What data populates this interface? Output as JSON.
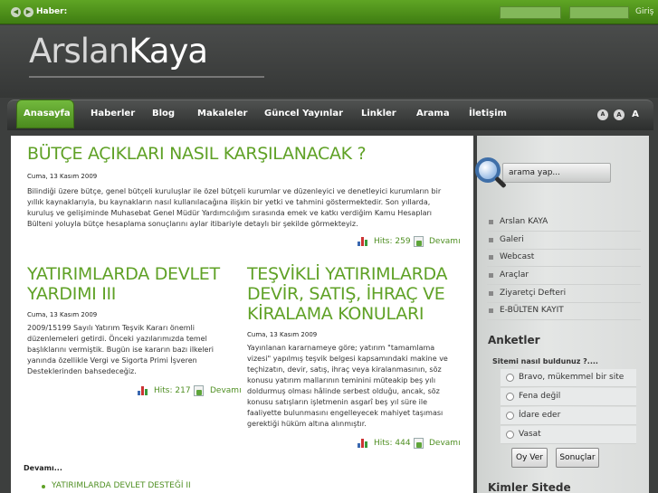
{
  "topbar": {
    "news_label": "Haber:",
    "login": "Giriş"
  },
  "header": {
    "logo_part1": "Arslan",
    "logo_part2": "Kaya"
  },
  "nav": {
    "items": [
      "Anasayfa",
      "Haberler",
      "Blog",
      "Makaleler",
      "Güncel Yayınlar",
      "Linkler",
      "Arama",
      "İletişim"
    ],
    "font_sizes": [
      "A",
      "A",
      "A"
    ]
  },
  "articles": [
    {
      "title": "BÜTÇE AÇIKLARI NASIL KARŞILANACAK ?",
      "date": "Cuma, 13 Kasım 2009",
      "body": "Bilindiği üzere bütçe, genel bütçeli kuruluşlar ile özel bütçeli kurumlar ve düzenleyici ve denetleyici kurumların bir yıllık kaynaklarıyla, bu kaynakların nasıl kullanılacağına ilişkin bir yetki ve tahmini göstermektedir. Son yıllarda, kuruluş ve gelişiminde Muhasebat Genel Müdür Yardımcılığım sırasında emek ve katkı verdiğim Kamu Hesapları Bülteni yoluyla bütçe hesaplama sonuçlarını aylar itibariyle detaylı bir şekilde görmekteyiz.",
      "hits": "Hits: 259",
      "more": "Devamı"
    },
    {
      "title": "YATIRIMLARDA DEVLET YARDIMI III",
      "date": "Cuma, 13 Kasım 2009",
      "body": "2009/15199 Sayılı Yatırım Teşvik Kararı önemli düzenlemeleri getirdi.  Önceki yazılarımızda temel başlıklarını vermiştik.        Bugün ise kararın bazı ilkeleri yanında özellikle Vergi ve Sigorta Primi İşveren Desteklerinden bahsedeceğiz.",
      "hits": "Hits: 217",
      "more": "Devamı"
    },
    {
      "title": "TEŞVİKLİ YATIRIMLARDA DEVİR, SATIŞ, İHRAÇ VE KİRALAMA KONULARI",
      "date": "Cuma, 13 Kasım 2009",
      "body": "Yayınlanan kararnameye göre; yatırım \"tamamlama vizesi\" yapılmış teşvik belgesi kapsamındaki makine ve teçhizatın, devir, satış, ihraç veya kiralanmasının, söz konusu yatırım mallarının teminini müteakip beş yılı doldurmuş olması hâlinde serbest olduğu, ancak, söz konusu satışların işletmenin asgarî beş yıl süre ile faaliyette bulunmasını engelleyecek mahiyet taşıması gerektiği hüküm altına alınmıştır.",
      "hits": "Hits: 444",
      "more": "Devamı"
    }
  ],
  "more_section": {
    "label": "Devamı...",
    "links": [
      "YATIRIMLARDA DEVLET DESTEĞİ II"
    ]
  },
  "sidebar": {
    "search_placeholder": "arama yap...",
    "menu": [
      "Arslan KAYA",
      "Galeri",
      "Webcast",
      "Araçlar",
      "Ziyaretçi Defteri",
      "E-BÜLTEN KAYIT"
    ],
    "poll_title": "Anketler",
    "poll_question": "Sitemi nasıl buldunuz ?....",
    "poll_options": [
      "Bravo, mükemmel bir site",
      "Fena değil",
      "İdare eder",
      "Vasat"
    ],
    "vote_button": "Oy Ver",
    "results_button": "Sonuçlar",
    "who_online": "Kimler Sitede"
  }
}
